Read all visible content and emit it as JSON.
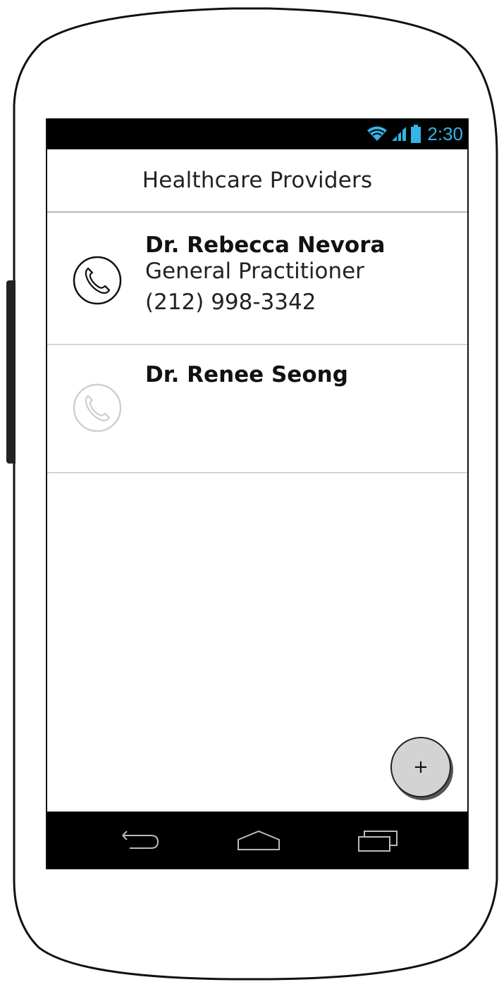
{
  "status_bar": {
    "time": "2:30",
    "icons": [
      "wifi-icon",
      "signal-icon",
      "battery-icon"
    ],
    "accent_color": "#33b5e5"
  },
  "header": {
    "title": "Healthcare Providers"
  },
  "providers": [
    {
      "name": "Dr. Rebecca Nevora",
      "specialty": "General Practitioner",
      "phone": "(212) 998-3342",
      "icon": "phone-icon",
      "call_enabled": true
    },
    {
      "name": "Dr. Renee Seong",
      "specialty": "",
      "phone": "",
      "icon": "phone-icon",
      "call_enabled": false
    }
  ],
  "fab": {
    "label": "+",
    "icon": "add-icon"
  },
  "nav_bar": {
    "icons": [
      "back-icon",
      "home-icon",
      "recents-icon"
    ]
  }
}
